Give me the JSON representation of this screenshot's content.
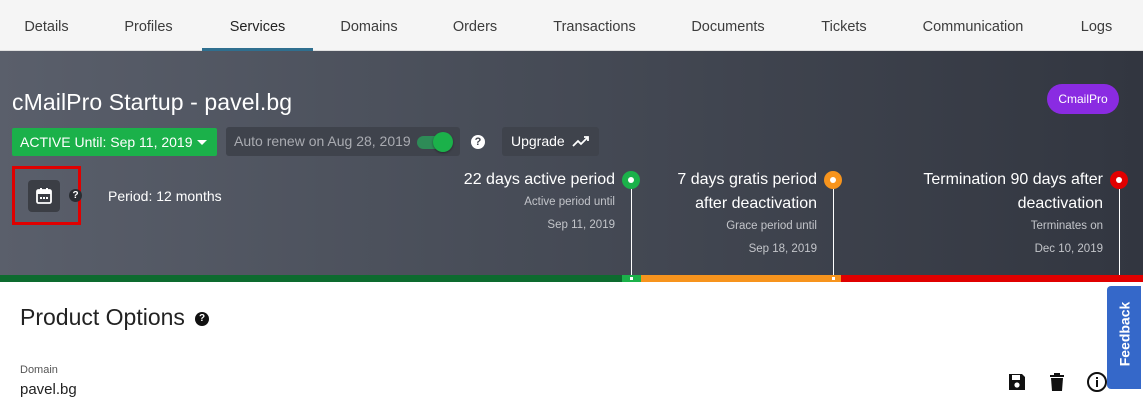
{
  "tabs": [
    {
      "label": "Details"
    },
    {
      "label": "Profiles"
    },
    {
      "label": "Services"
    },
    {
      "label": "Domains"
    },
    {
      "label": "Orders"
    },
    {
      "label": "Transactions"
    },
    {
      "label": "Documents"
    },
    {
      "label": "Tickets"
    },
    {
      "label": "Communication"
    },
    {
      "label": "Logs"
    }
  ],
  "active_tab": "Services",
  "service": {
    "title": "cMailPro Startup - pavel.bg",
    "badge": "CmailPro",
    "badge_color": "#8a2be2",
    "status_label": "ACTIVE Until: Sep 11, 2019",
    "status_color": "#1bb14a",
    "auto_renew_label": "Auto renew on Aug 28, 2019",
    "auto_renew_enabled": true,
    "upgrade_label": "Upgrade",
    "period_label": "Period: 12 months",
    "help_glyph": "?"
  },
  "phases": [
    {
      "title_line1": "22 days active period",
      "title_line2": "",
      "sub_label": "Active period until",
      "date": "Sep 11, 2019",
      "color": "#1bb14a",
      "icon": "status-dot"
    },
    {
      "title_line1": "7 days gratis period",
      "title_line2": "after deactivation",
      "sub_label": "Grace period until",
      "date": "Sep 18, 2019",
      "color": "#f7941d",
      "icon": "status-dot"
    },
    {
      "title_line1": "Termination 90 days after",
      "title_line2": "deactivation",
      "sub_label": "Terminates on",
      "date": "Dec 10, 2019",
      "color": "#e00000",
      "icon": "status-dot"
    }
  ],
  "timeline_colors": {
    "active": "#0d6b2f",
    "grace": "#f7941d",
    "termination": "#e00000"
  },
  "product_options": {
    "title": "Product Options",
    "domain_label": "Domain",
    "domain_value": "pavel.bg",
    "actions": [
      "save-icon",
      "trash-icon",
      "info-icon"
    ]
  },
  "feedback": {
    "label": "Feedback",
    "color": "#3568c9"
  }
}
